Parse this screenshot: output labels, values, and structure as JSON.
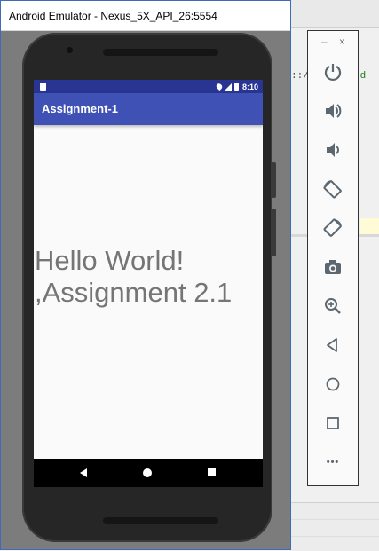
{
  "window": {
    "title": "Android Emulator - Nexus_5X_API_26:5554"
  },
  "device": {
    "status_bar": {
      "time": "8:10"
    },
    "app_bar": {
      "title": "Assignment-1"
    },
    "content": {
      "text": "Hello World! ,Assignment 2.1"
    },
    "nav": {
      "back_icon": "back-triangle-icon",
      "home_icon": "home-circle-icon",
      "recents_icon": "recents-square-icon"
    }
  },
  "ide_background": {
    "code_fragment_1": "::/",
    "code_fragment_2": ".and"
  },
  "toolbar": {
    "minimize_label": "–",
    "close_label": "×",
    "more_label": "•••",
    "buttons": [
      "power-icon",
      "volume-up-icon",
      "volume-down-icon",
      "rotate-left-icon",
      "rotate-right-icon",
      "screenshot-icon",
      "zoom-icon",
      "back-icon",
      "home-icon",
      "overview-icon",
      "more-icon"
    ]
  },
  "colors": {
    "app_bar": "#3f51b5",
    "status_bar": "#283593",
    "text": "#757575",
    "toolbar_icon": "#5c6770"
  }
}
